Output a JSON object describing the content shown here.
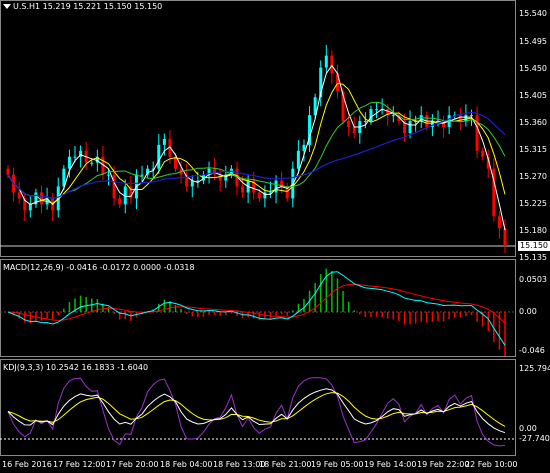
{
  "header": {
    "symbol": "U.S.H1",
    "ohlc": "15.219 15.221 15.150 15.150",
    "dropdown_icon": "triangle-down-icon"
  },
  "price_axis": {
    "ticks": [
      "15.540",
      "15.495",
      "15.450",
      "15.405",
      "15.360",
      "15.315",
      "15.270",
      "15.225",
      "15.180",
      "15.135"
    ],
    "current_price": "15.150"
  },
  "macd": {
    "title": "MACD(12,26,9) -0.0416 -0.0172 0.0000 -0.0318",
    "ticks": [
      "0.0503",
      "0.00",
      "-0.046"
    ]
  },
  "kdj": {
    "title": "KDJ(9,3,3) 10.2542 16.1833 -1.6040",
    "ticks": [
      "125.7940",
      "0.00",
      "-27.7401"
    ]
  },
  "time_axis": {
    "labels": [
      "16 Feb 2016",
      "17 Feb 12:00",
      "17 Feb 20:00",
      "18 Feb 04:00",
      "18 Feb 13:00",
      "18 Feb 21:00",
      "19 Feb 05:00",
      "19 Feb 14:00",
      "19 Feb 22:00",
      "22 Feb 10:00"
    ]
  },
  "colors": {
    "bull": "#00ffff",
    "bear": "#ff0000",
    "ma_white": "#ffffff",
    "ma_yellow": "#ffff00",
    "ma_green": "#32cd32",
    "ma_blue": "#1e1ecd",
    "macd_signal": "#ff0000",
    "macd_line": "#00ffff",
    "kdj_k": "#ffffff",
    "kdj_d": "#ffff00",
    "kdj_j": "#9932cc"
  },
  "chart_data": {
    "type": "candlestick",
    "closes": [
      15.27,
      15.24,
      15.23,
      15.21,
      15.22,
      15.24,
      15.22,
      15.23,
      15.21,
      15.25,
      15.28,
      15.3,
      15.3,
      15.31,
      15.29,
      15.29,
      15.3,
      15.27,
      15.27,
      15.23,
      15.22,
      15.25,
      15.23,
      15.27,
      15.27,
      15.28,
      15.28,
      15.32,
      15.33,
      15.3,
      15.28,
      15.27,
      15.25,
      15.26,
      15.26,
      15.27,
      15.28,
      15.27,
      15.26,
      15.27,
      15.28,
      15.25,
      15.24,
      15.26,
      15.24,
      15.23,
      15.24,
      15.24,
      15.26,
      15.25,
      15.23,
      15.28,
      15.31,
      15.32,
      15.37,
      15.4,
      15.45,
      15.47,
      15.44,
      15.41,
      15.36,
      15.35,
      15.34,
      15.36,
      15.36,
      15.38,
      15.38,
      15.38,
      15.37,
      15.37,
      15.36,
      15.34,
      15.36,
      15.36,
      15.37,
      15.35,
      15.36,
      15.36,
      15.35,
      15.37,
      15.37,
      15.36,
      15.37,
      15.37,
      15.31,
      15.3,
      15.28,
      15.2,
      15.18,
      15.15
    ]
  }
}
